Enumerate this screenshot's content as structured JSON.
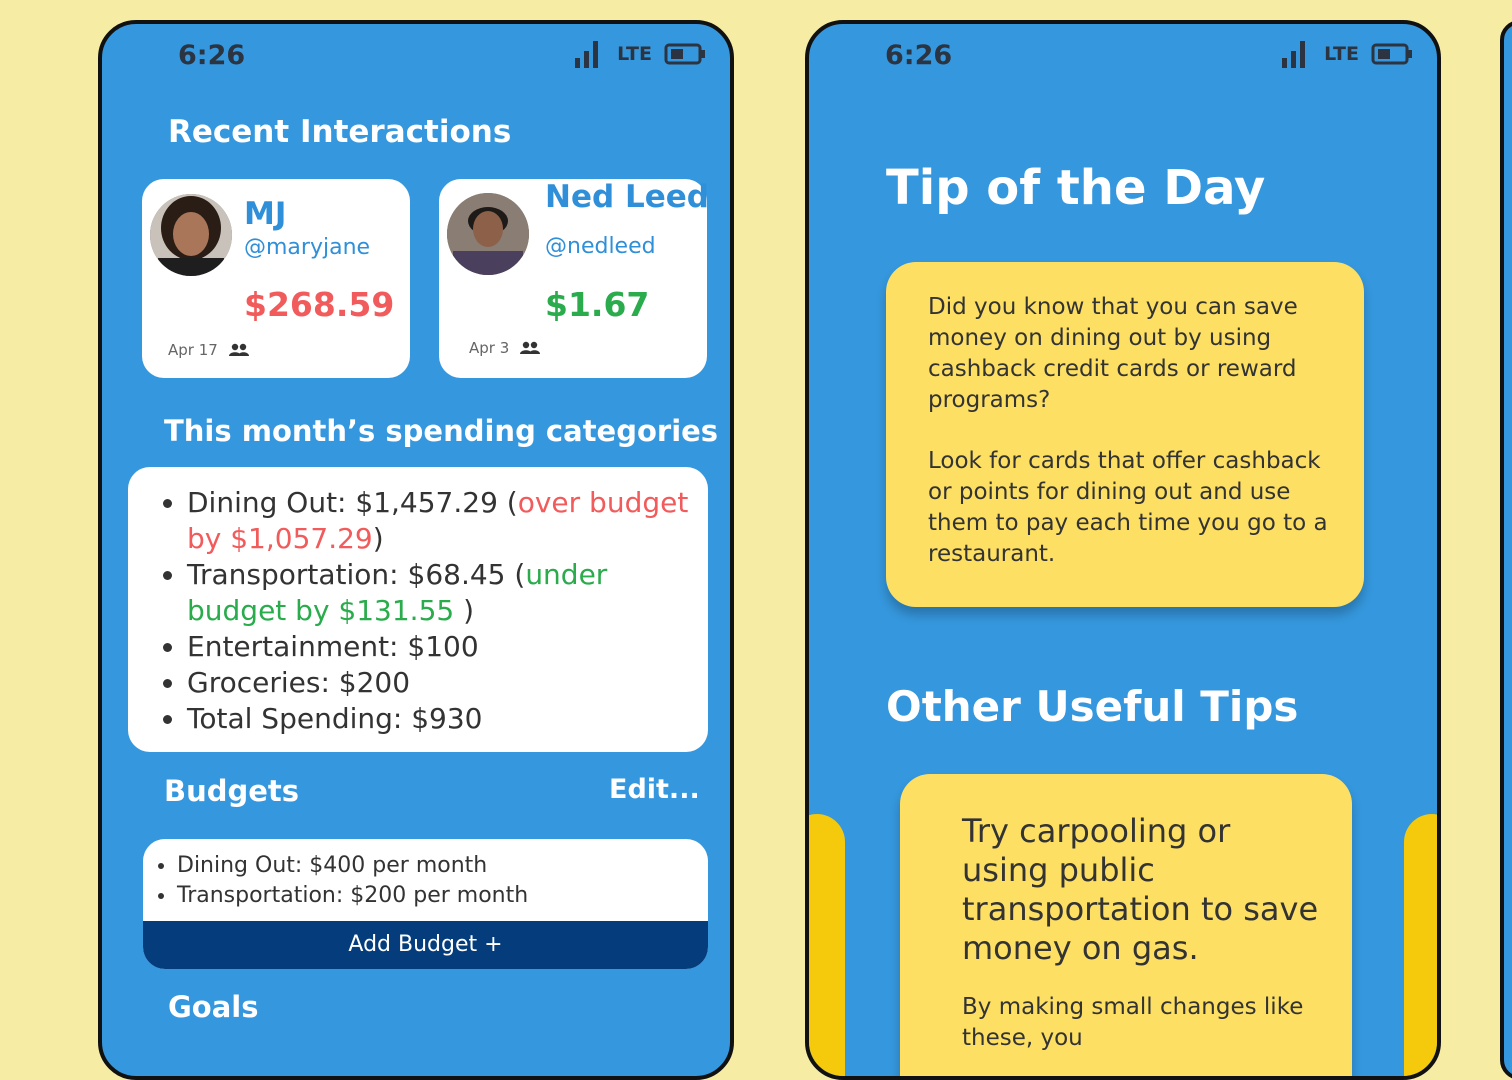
{
  "phone1": {
    "time": "6:26",
    "network": "LTE",
    "recent_title": "Recent Interactions",
    "contacts": [
      {
        "name": "MJ",
        "handle": "@maryjane",
        "amount": "$268.59",
        "date": "Apr 17",
        "amount_color": "#f15b5b"
      },
      {
        "name": "Ned Leed",
        "handle": "@nedleed",
        "amount": "$1.67",
        "date": "Apr 3",
        "amount_color": "#2aab4c"
      }
    ],
    "categories_title": "This month’s spending categories",
    "categories": {
      "dining_prefix": "Dining Out: $1,457.29 (",
      "dining_note": "over budget by $1,057.29",
      "dining_suffix": ")",
      "transport_prefix": "Transportation: $68.45 (",
      "transport_note": "under budget by $131.55",
      "transport_suffix": " )",
      "entertainment": "Entertainment: $100",
      "groceries": "Groceries: $200",
      "total": "Total Spending: $930"
    },
    "budgets_title": "Budgets",
    "budgets_edit": "Edit...",
    "budgets": [
      "Dining Out: $400 per month",
      "Transportation: $200 per month"
    ],
    "add_budget": "Add Budget +",
    "goals_title": "Goals"
  },
  "phone2": {
    "time": "6:26",
    "network": "LTE",
    "tip_title": "Tip of the Day",
    "tip_p1": "Did you know that you can save money on dining out by using cashback credit cards or reward programs?",
    "tip_p2": "Look for cards that offer cashback or points for dining out and use them to pay each time you go to a restaurant.",
    "other_title": "Other Useful Tips",
    "other_tip_main": "Try carpooling or using public transportation to save money on gas.",
    "other_tip_sub": "By making small changes like these, you"
  },
  "colors": {
    "background": "#f6eca4",
    "phone": "#3597dd",
    "tip_card": "#fcdf63",
    "button": "#043c7c",
    "negative": "#f15b5b",
    "positive": "#2aab4c"
  }
}
